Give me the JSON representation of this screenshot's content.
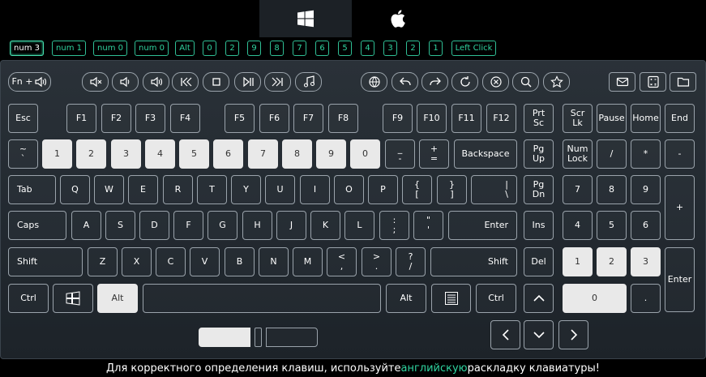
{
  "os_tabs": [
    {
      "id": "windows",
      "icon": "windows-logo-icon",
      "active": true
    },
    {
      "id": "mac",
      "icon": "apple-logo-icon",
      "active": false
    }
  ],
  "history": [
    "num 3",
    "num 1",
    "num 0",
    "num 0",
    "Alt",
    "0",
    "2",
    "9",
    "8",
    "7",
    "6",
    "5",
    "4",
    "3",
    "2",
    "1",
    "Left Click"
  ],
  "toolbar": {
    "fn_label": "Fn +",
    "icons": [
      "mute-icon",
      "volume-down-icon",
      "volume-up-icon",
      "previous-track-icon",
      "stop-icon",
      "play-pause-icon",
      "next-track-icon",
      "music-icon",
      "browser-home-icon",
      "back-icon",
      "forward-icon",
      "refresh-icon",
      "stop-browser-icon",
      "search-icon",
      "favorites-icon",
      "mail-icon",
      "calculator-icon",
      "folder-icon"
    ]
  },
  "keys": {
    "esc": "Esc",
    "f1": "F1",
    "f2": "F2",
    "f3": "F3",
    "f4": "F4",
    "f5": "F5",
    "f6": "F6",
    "f7": "F7",
    "f8": "F8",
    "f9": "F9",
    "f10": "F10",
    "f11": "F11",
    "f12": "F12",
    "prtsc": "Prt\nSc",
    "scrlk": "Scr\nLk",
    "pause": "Pause",
    "home": "Home",
    "end": "End",
    "tilde": "~\n`",
    "d1": "1",
    "d2": "2",
    "d3": "3",
    "d4": "4",
    "d5": "5",
    "d6": "6",
    "d7": "7",
    "d8": "8",
    "d9": "9",
    "d0": "0",
    "minus": "_\n-",
    "equal": "+\n=",
    "backspace": "Backspace",
    "pgup": "Pg\nUp",
    "numlock": "Num\nLock",
    "nslash": "/",
    "nstar": "*",
    "nminus": "-",
    "tab": "Tab",
    "q": "Q",
    "w": "W",
    "e": "E",
    "r": "R",
    "t": "T",
    "y": "Y",
    "u": "U",
    "i": "I",
    "o": "O",
    "p": "P",
    "lbrace": "{\n[",
    "rbrace": "}\n]",
    "pipe": "|\n\\",
    "pgdn": "Pg\nDn",
    "n7": "7",
    "n8": "8",
    "n9": "9",
    "nplus": "+",
    "caps": "Caps",
    "a": "A",
    "s": "S",
    "d": "D",
    "f": "F",
    "g": "G",
    "h": "H",
    "j": "J",
    "k": "K",
    "l": "L",
    "colon": ":\n;",
    "quote": "\"\n'",
    "enter": "Enter",
    "ins": "Ins",
    "n4": "4",
    "n5": "5",
    "n6": "6",
    "lshift": "Shift",
    "z": "Z",
    "x": "X",
    "c": "C",
    "v": "V",
    "b": "B",
    "n": "N",
    "m": "M",
    "lt": "<\n,",
    "gt": ">\n.",
    "question": "?\n/",
    "rshift": "Shift",
    "del": "Del",
    "n1": "1",
    "n2": "2",
    "n3": "3",
    "nenter": "Enter",
    "lctrl": "Ctrl",
    "lalt": "Alt",
    "ralt": "Alt",
    "rctrl": "Ctrl",
    "n0": "0",
    "ndot": "."
  },
  "lit_keys": [
    "d1",
    "d2",
    "d3",
    "d4",
    "d5",
    "d6",
    "d7",
    "d8",
    "d9",
    "d0",
    "lalt",
    "n1",
    "n2",
    "n3",
    "n0"
  ],
  "footer": {
    "before": "Для корректного определения клавиш, используйте ",
    "highlight": "английскую",
    "after": " раскладку клавиатуры!"
  },
  "colors": {
    "accent": "#2fd39f",
    "key_border": "#9aa3ab",
    "lit_key": "#e9e9e9",
    "panel": "#262d34"
  }
}
